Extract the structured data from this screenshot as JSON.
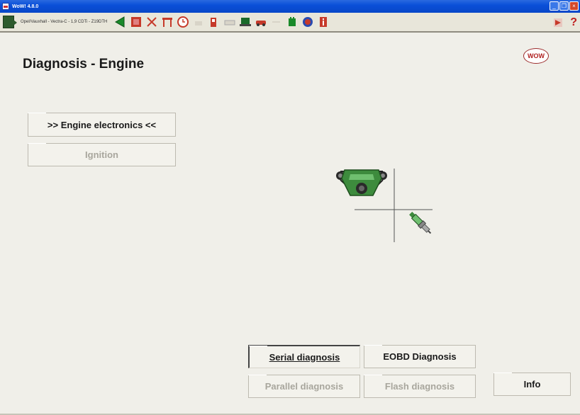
{
  "window": {
    "title": "WoW! 4.8.0"
  },
  "toolbar": {
    "vehicle": "Opel/Vauxhall - Vectra-C - 1,9 CDTi - Z19DTH",
    "icons": [
      "back-arrow-icon",
      "book-icon",
      "wrench-icon",
      "car-lift-icon",
      "clock-icon",
      "oil-can-icon",
      "gas-pump-icon",
      "keyboard-icon",
      "laptop-icon",
      "car-icon",
      "battery-icon",
      "tire-icon",
      "info-icon"
    ],
    "help": "?"
  },
  "page": {
    "title": "Diagnosis - Engine",
    "logo_text": "WOW"
  },
  "menu": {
    "engine_electronics": ">> Engine electronics <<",
    "ignition": "Ignition"
  },
  "actions": {
    "serial": "Serial diagnosis",
    "eobd": "EOBD Diagnosis",
    "parallel": "Parallel diagnosis",
    "flash": "Flash diagnosis",
    "info": "Info"
  },
  "colors": {
    "titlebar": "#0a4fd8",
    "background": "#f0efe9",
    "engine_green": "#3d8b3d",
    "disabled_text": "#a8a69d"
  }
}
